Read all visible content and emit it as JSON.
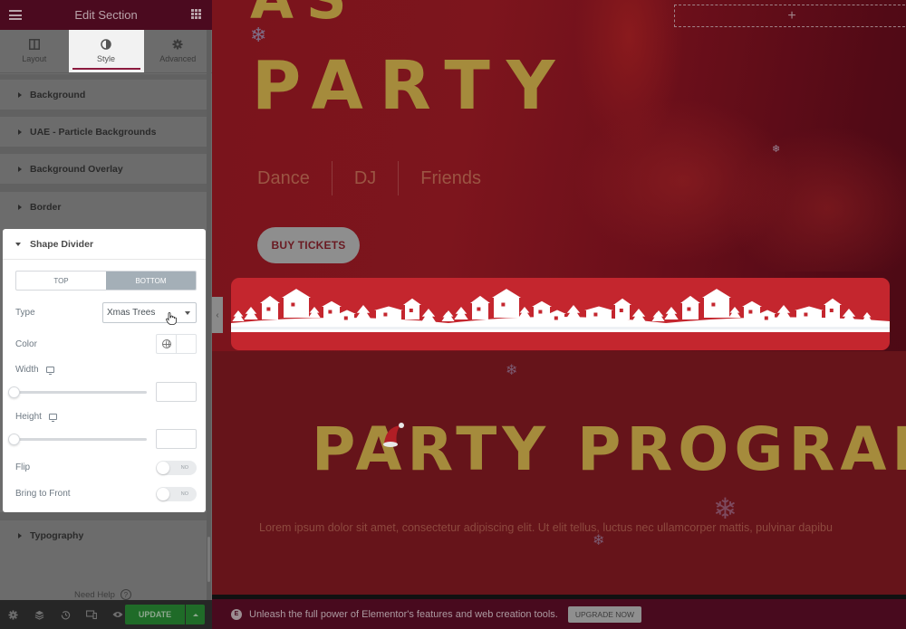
{
  "panel": {
    "title": "Edit Section",
    "menu_icon": "hamburger-icon",
    "apps_icon": "grid-icon",
    "tabs": [
      {
        "label": "Layout",
        "icon": "columns-icon",
        "active": false
      },
      {
        "label": "Style",
        "icon": "half-circle-icon",
        "active": true
      },
      {
        "label": "Advanced",
        "icon": "gear-icon",
        "active": false
      }
    ],
    "sections_top": [
      {
        "label": "Background"
      },
      {
        "label": "UAE - Particle Backgrounds"
      },
      {
        "label": "Background Overlay"
      },
      {
        "label": "Border"
      }
    ],
    "shape_divider": {
      "label": "Shape Divider",
      "position_tabs": [
        {
          "label": "TOP",
          "active": false
        },
        {
          "label": "BOTTOM",
          "active": true
        }
      ],
      "type_label": "Type",
      "type_value": "Xmas Trees",
      "color_label": "Color",
      "width_label": "Width",
      "width_value": "",
      "height_label": "Height",
      "height_value": "",
      "flip_label": "Flip",
      "flip_state": "NO",
      "front_label": "Bring to Front",
      "front_state": "NO"
    },
    "sections_bottom": [
      {
        "label": "Typography"
      }
    ],
    "need_help": "Need Help",
    "footer": {
      "icons": [
        "settings-icon",
        "layers-icon",
        "history-icon",
        "responsive-icon",
        "preview-icon"
      ],
      "update_label": "UPDATE"
    }
  },
  "canvas": {
    "hero_title_top": "AS",
    "hero_title": "PARTY",
    "nav": [
      "Dance",
      "DJ",
      "Friends"
    ],
    "buy_button": "BUY TICKETS",
    "add_section_symbol": "+",
    "program_title": "PARTY PROGRAM",
    "lorem": "Lorem ipsum dolor sit amet, consectetur adipiscing elit. Ut elit tellus, luctus nec ullamcorper mattis, pulvinar dapibu",
    "edge_handle_symbol": "‹"
  },
  "promo": {
    "message": "Unleash the full power of Elementor's features and web creation tools.",
    "button": "UPGRADE NOW"
  },
  "colors": {
    "header_bg": "#4b0a1f",
    "accent": "#8c1a3f",
    "update_green": "#1f6b28",
    "title_gold": "#a58b3c",
    "divider_red": "#c4262e"
  }
}
